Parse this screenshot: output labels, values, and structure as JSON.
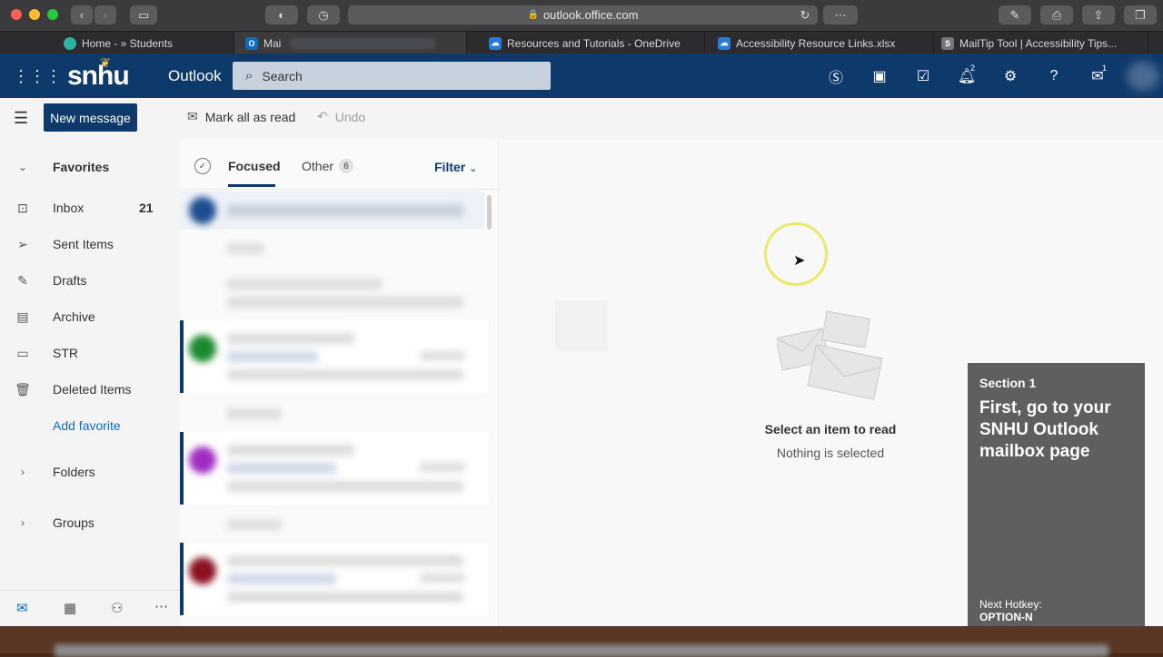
{
  "browser": {
    "url": "outlook.office.com",
    "tabs": [
      {
        "label": "Home - » Students",
        "icon": "students-icon",
        "color": "#2bb3a0"
      },
      {
        "label": "Mai",
        "icon": "outlook-icon",
        "color": "#0f6cbd"
      },
      {
        "label": "Resources and Tutorials - OneDrive",
        "icon": "onedrive-icon",
        "color": "#2d7ad6"
      },
      {
        "label": "Accessibility Resource Links.xlsx",
        "icon": "onedrive-icon",
        "color": "#2d7ad6"
      },
      {
        "label": "MailTip Tool | Accessibility Tips...",
        "icon": "s-icon",
        "color": "#777777"
      }
    ]
  },
  "header": {
    "logo": "snhu",
    "app_name": "Outlook",
    "search_placeholder": "Search",
    "notification_count": "2",
    "feedback_count": "1"
  },
  "commandbar": {
    "new_message": "New message",
    "mark_all_read": "Mark all as read",
    "undo": "Undo"
  },
  "nav": {
    "favorites": "Favorites",
    "inbox": "Inbox",
    "inbox_count": "21",
    "sent": "Sent Items",
    "drafts": "Drafts",
    "archive": "Archive",
    "str": "STR",
    "deleted": "Deleted Items",
    "add_favorite": "Add favorite",
    "folders": "Folders",
    "groups": "Groups"
  },
  "list": {
    "focused": "Focused",
    "other": "Other",
    "other_count": "6",
    "filter": "Filter"
  },
  "reading": {
    "title": "Select an item to read",
    "subtitle": "Nothing is selected"
  },
  "overlay": {
    "section": "Section 1",
    "instruction": "First, go to your SNHU Outlook mailbox page",
    "hotkey_label": "Next Hotkey:",
    "hotkey": "OPTION-N"
  },
  "colors": {
    "brand": "#0e3a6b",
    "accent": "#0f6cbd"
  }
}
